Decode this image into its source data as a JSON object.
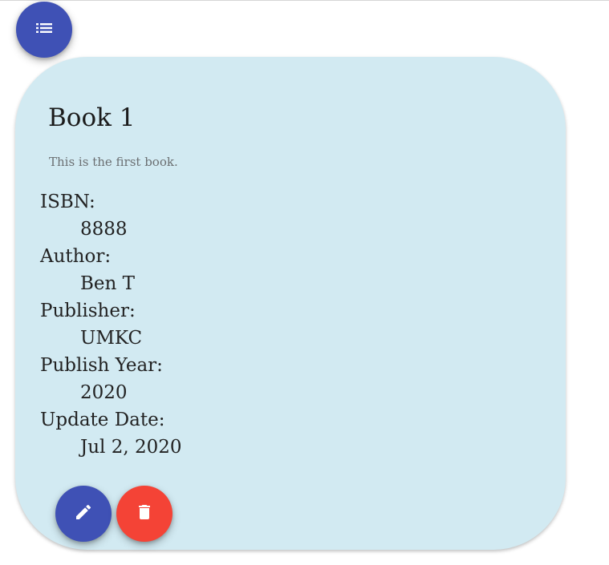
{
  "colors": {
    "primary": "#3f51b5",
    "danger": "#f44336",
    "card_background": "#d2eaf2"
  },
  "toolbar": {
    "list_button_icon": "list-icon"
  },
  "book": {
    "title": "Book 1",
    "description": "This is the first book.",
    "fields": [
      {
        "label": "ISBN:",
        "value": "8888"
      },
      {
        "label": "Author:",
        "value": "Ben T"
      },
      {
        "label": "Publisher:",
        "value": "UMKC"
      },
      {
        "label": "Publish Year:",
        "value": "2020"
      },
      {
        "label": "Update Date:",
        "value": "Jul 2, 2020"
      }
    ]
  },
  "actions": {
    "edit_icon": "pencil-icon",
    "delete_icon": "trash-icon"
  }
}
